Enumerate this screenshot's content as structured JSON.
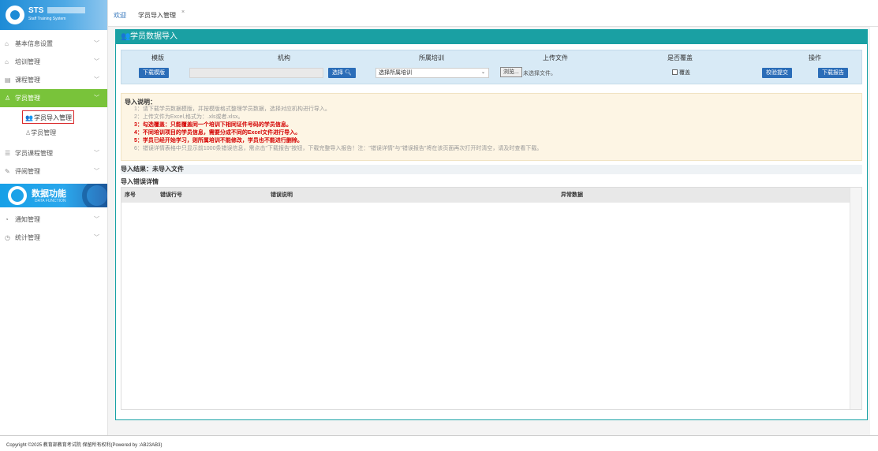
{
  "logo": {
    "title": "STS",
    "subtitle": "Staff Training System"
  },
  "sidebar": {
    "items": [
      {
        "label": "基本信息设置",
        "icon": "⌂"
      },
      {
        "label": "培训管理",
        "icon": "⌂"
      },
      {
        "label": "课程管理",
        "icon": "▤"
      },
      {
        "label": "学员管理",
        "icon": "♙"
      },
      {
        "label": "学员课程管理",
        "icon": "☰"
      },
      {
        "label": "评阅管理",
        "icon": "✎"
      },
      {
        "label": "通知管理",
        "icon": "◔"
      },
      {
        "label": "统计管理",
        "icon": "◷"
      }
    ],
    "sub_items": [
      {
        "label": "学员导入管理"
      },
      {
        "label": "学员管理"
      }
    ],
    "data_banner": {
      "title": "数据功能",
      "subtitle": "DATA FUNCTION"
    },
    "active_color": "#79c33a"
  },
  "tabs": {
    "home": "欢迎",
    "current": "学员导入管理"
  },
  "panel": {
    "title": "学员数据导入",
    "head_color": "#1aa0a3"
  },
  "form": {
    "template_label": "模版",
    "template_button": "下载模版",
    "org_label": "机构",
    "org_button": "选择",
    "training_label": "所属培训",
    "training_selected": "选择所属培训",
    "upload_label": "上传文件",
    "browse_button": "浏览...",
    "no_file_text": "未选择文件。",
    "overwrite_label": "是否覆盖",
    "overwrite_option": "覆盖",
    "actions_label": "操作",
    "verify_button": "校验提交",
    "report_button": "下载报告"
  },
  "notice": {
    "title": "导入说明：",
    "lines": [
      {
        "text": "1：请下载学员数据模版，并按模版格式整理学员数据，选择对应机构进行导入。",
        "red": false
      },
      {
        "text": "2：上传文件为Excel,格式为：.xls或者.xlsx。",
        "red": false
      },
      {
        "text": "3：勾选覆盖：只能覆盖同一个培训下相同证件号码的学员信息。",
        "red": true
      },
      {
        "text": "4：不同培训项目的学员信息，需要分成不同的Excel文件进行导入。",
        "red": true
      },
      {
        "text": "5：学员已经开始学习，则所属培训不能修改，学员也不能进行删除。",
        "red": true
      },
      {
        "text": "6：错误详情表格中只显示前1000条错误信息，需点击\"下载报告\"按钮，下载完整导入报告！注：\"错误详情\"与\"错误报告\"将在该页面再次打开时清空，请及时查看下载。",
        "red": false
      }
    ]
  },
  "result": {
    "text": "导入结果：未导入文件"
  },
  "detail": {
    "title": "导入错误详情",
    "columns": [
      "序号",
      "错误行号",
      "错误说明",
      "异常数据"
    ]
  },
  "footer": {
    "text": "Copyright ©2025 教育部教育考试院 保留所有权利(Powered by :AB23AB3)"
  }
}
